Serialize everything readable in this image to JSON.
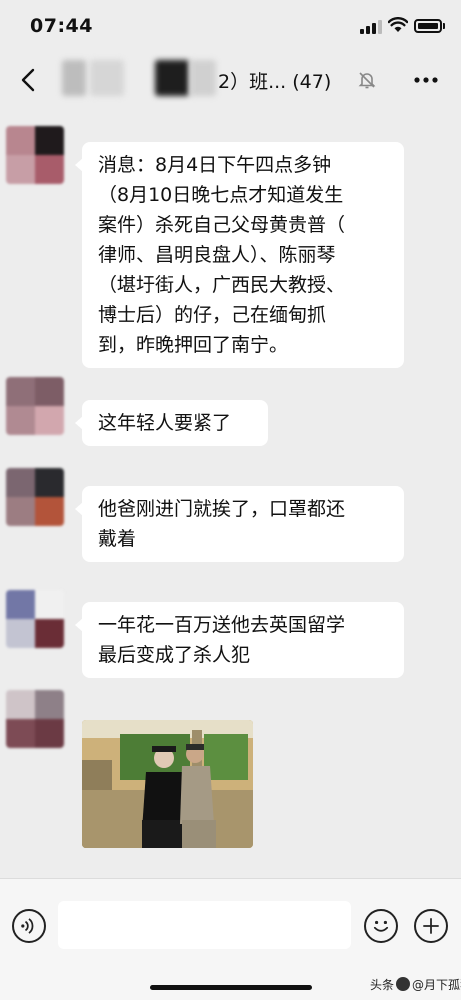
{
  "status_bar": {
    "time": "07:44"
  },
  "nav": {
    "title": "2）班...  (47)"
  },
  "messages": [
    {
      "text": "消息：8月4日下午四点多钟\n（8月10日晚七点才知道发生\n案件）杀死自己父母黄贵普（\n律师、昌明良盘人）、陈丽琴\n（堪圩街人，广西民大教授、\n博士后）的仔，己在缅甸抓\n到，昨晚押回了南宁。"
    },
    {
      "text": "这年轻人要紧了"
    },
    {
      "text": "他爸刚进门就挨了，口罩都还\n戴着"
    },
    {
      "text": "一年花一百万送他去英国留学\n最后变成了杀人犯"
    }
  ],
  "watermark": {
    "platform": "头条",
    "author": "@月下孤独客"
  },
  "colors": {
    "background": "#ededed",
    "bubble": "#ffffff"
  }
}
